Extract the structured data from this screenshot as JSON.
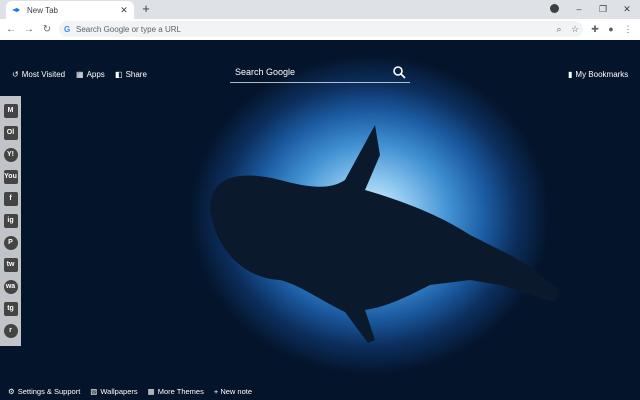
{
  "browser": {
    "tab_title": "New Tab",
    "tab_close": "✕",
    "new_tab": "+",
    "window_controls": [
      "–",
      "❐",
      "✕"
    ],
    "omnibox_placeholder": "Search Google or type a URL",
    "omnibox_g": "G"
  },
  "topnav": {
    "most_visited": "Most Visited",
    "apps": "Apps",
    "share": "Share",
    "bookmarks": "My Bookmarks"
  },
  "search": {
    "placeholder": "Search Google"
  },
  "social": [
    "M",
    "Ol",
    "Y!",
    "You",
    "f",
    "ig",
    "P",
    "tw",
    "wa",
    "tg",
    "r"
  ],
  "footer": {
    "settings": "Settings & Support",
    "wallpapers": "Wallpapers",
    "themes": "More Themes",
    "note": "+ New note"
  }
}
